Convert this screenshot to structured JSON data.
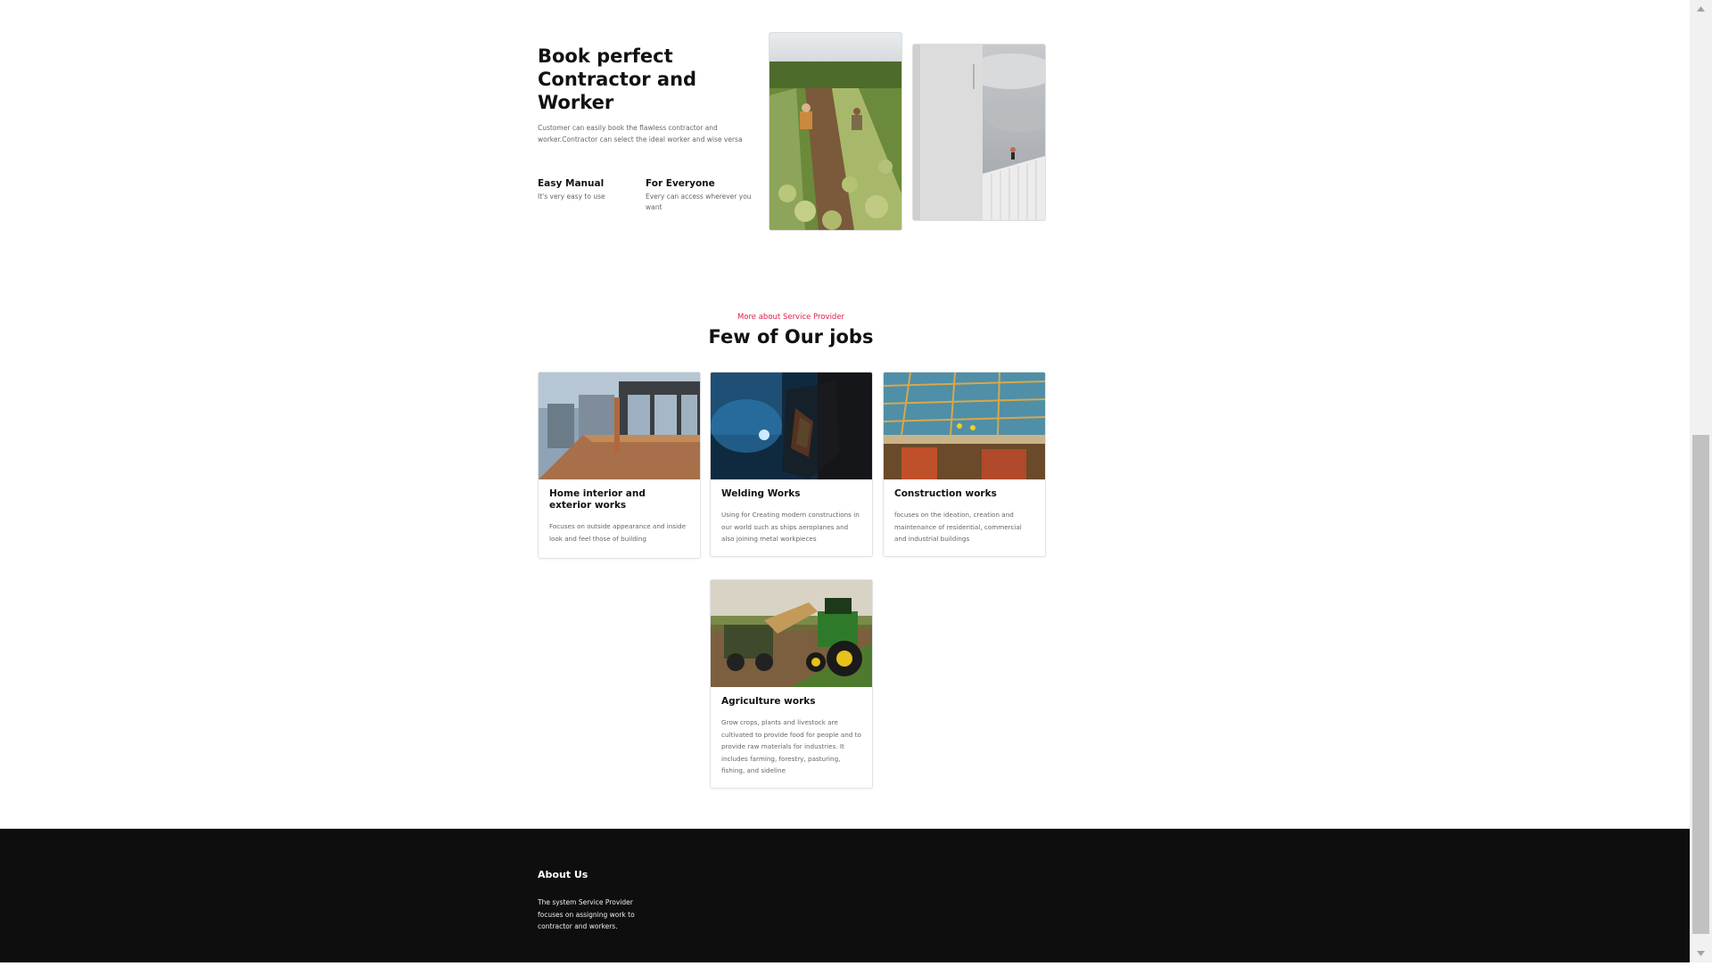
{
  "hero": {
    "title": "Book perfect Contractor and Worker",
    "description": "Customer can easily book the flawless contractor and worker.Contractor can select the ideal worker and wise versa",
    "features": [
      {
        "title": "Easy Manual",
        "desc": "It's very easy to use"
      },
      {
        "title": "For Everyone",
        "desc": "Every can access wherever you want"
      }
    ]
  },
  "jobs": {
    "eyebrow": "More about Service Provider",
    "title": "Few of Our jobs",
    "cards": [
      {
        "title": "Home interior and exterior works",
        "desc": "Focuses on outside appearance and inside look and feel those of building"
      },
      {
        "title": "Welding Works",
        "desc": "Using for Creating modern constructions in our world such as ships aeroplanes and also joining metal workpieces"
      },
      {
        "title": "Construction works",
        "desc": "focuses on the ideation, creation and maintenance of residential, commercial and industrial buildings"
      },
      {
        "title": "Agriculture works",
        "desc": "Grow crops, plants and livestock are cultivated to provide food for people and to provide raw materials for industries. It includes farming, forestry, pasturing, fishing, and sideline"
      }
    ]
  },
  "footer": {
    "heading": "About Us",
    "text": "The system Service Provider focuses on assigning work to contractor and workers."
  },
  "colors": {
    "accent": "#e11d48",
    "footer_bg": "#0e0e0e"
  }
}
